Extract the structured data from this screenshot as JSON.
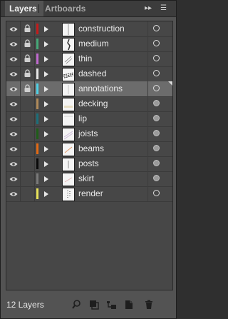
{
  "tabs": [
    {
      "label": "Layers",
      "active": true
    },
    {
      "label": "Artboards",
      "active": false
    }
  ],
  "panel_controls": {
    "collapse_label": "▸▸",
    "menu_label": "☰"
  },
  "layers": [
    {
      "name": "construction",
      "visible": true,
      "locked": true,
      "color": "#c51b1b",
      "target_filled": false,
      "selected": false
    },
    {
      "name": "medium",
      "visible": true,
      "locked": true,
      "color": "#46a878",
      "target_filled": false,
      "selected": false
    },
    {
      "name": "thin",
      "visible": true,
      "locked": true,
      "color": "#c06ad0",
      "target_filled": false,
      "selected": false
    },
    {
      "name": "dashed",
      "visible": true,
      "locked": true,
      "color": "#e6e6e6",
      "target_filled": false,
      "selected": false
    },
    {
      "name": "annotations",
      "visible": true,
      "locked": true,
      "color": "#4fd1e6",
      "target_filled": false,
      "selected": true
    },
    {
      "name": "decking",
      "visible": true,
      "locked": false,
      "color": "#b08a5a",
      "target_filled": true,
      "selected": false
    },
    {
      "name": "lip",
      "visible": true,
      "locked": false,
      "color": "#1c6f7a",
      "target_filled": true,
      "selected": false
    },
    {
      "name": "joists",
      "visible": true,
      "locked": false,
      "color": "#1f5e18",
      "target_filled": true,
      "selected": false
    },
    {
      "name": "beams",
      "visible": true,
      "locked": false,
      "color": "#e36a14",
      "target_filled": true,
      "selected": false
    },
    {
      "name": "posts",
      "visible": true,
      "locked": false,
      "color": "#0a0a0a",
      "target_filled": true,
      "selected": false
    },
    {
      "name": "skirt",
      "visible": true,
      "locked": false,
      "color": "#7a7a7a",
      "target_filled": true,
      "selected": false
    },
    {
      "name": "render",
      "visible": true,
      "locked": false,
      "color": "#e8e25a",
      "target_filled": false,
      "selected": false
    }
  ],
  "footer": {
    "count_label": "12 Layers",
    "buttons": [
      "locate-object",
      "make-clipping-mask",
      "create-sublayer",
      "create-new-layer",
      "delete-layer"
    ]
  }
}
